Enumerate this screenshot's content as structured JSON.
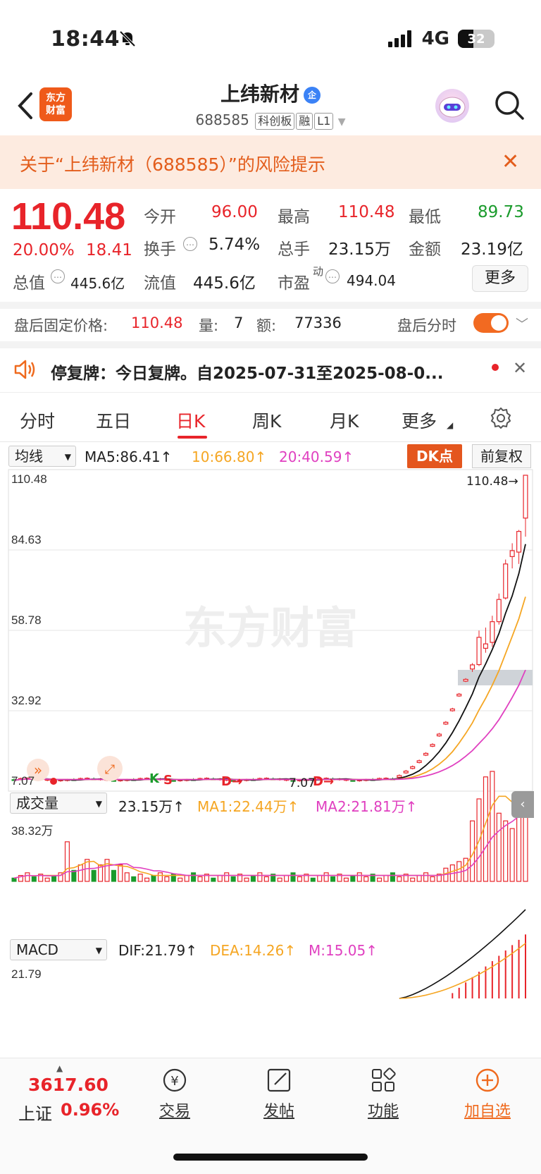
{
  "status": {
    "time": "18:44",
    "network": "4G",
    "battery": "32"
  },
  "header": {
    "logo": "东方财富",
    "title": "上纬新材",
    "title_badge": "企",
    "code": "688585",
    "tags": [
      "科创板",
      "融",
      "L1"
    ]
  },
  "risk_banner": {
    "text": "关于“上纬新材（688585）”的风险提示"
  },
  "quote": {
    "price": "110.48",
    "change_pct": "20.00%",
    "change": "18.41",
    "open_label": "今开",
    "open": "96.00",
    "high_label": "最高",
    "high": "110.48",
    "low_label": "最低",
    "low": "89.73",
    "turnover_label": "换手",
    "turnover": "5.74%",
    "volume_label": "总手",
    "volume": "23.15万",
    "amount_label": "金额",
    "amount": "23.19亿",
    "mktcap_label": "总值",
    "mktcap": "445.6亿",
    "float_label": "流值",
    "float": "445.6亿",
    "pe_label": "市盈",
    "pe_sup": "动",
    "pe": "494.04",
    "more": "更多"
  },
  "after_hours": {
    "label": "盘后固定价格:",
    "price": "110.48",
    "vol_label": "量:",
    "vol": "7",
    "amt_label": "额:",
    "amt": "77336",
    "timeshare": "盘后分时"
  },
  "notice": {
    "text": "停复牌：今日复牌。自2025-07-31至2025-08-0..."
  },
  "tabs": [
    "分时",
    "五日",
    "日K",
    "周K",
    "月K",
    "更多"
  ],
  "kline": {
    "indicator": "均线",
    "ma5": "MA5:86.41↑",
    "ma10": "10:66.80↑",
    "ma20": "20:40.59↑",
    "dk": "DK点",
    "adjust": "前复权",
    "y_labels": [
      "110.48",
      "84.63",
      "58.78",
      "32.92",
      "7.07"
    ],
    "last_label": "110.48→",
    "low_label": "7.07",
    "markers": [
      "K",
      "S",
      "D→",
      "D→"
    ],
    "watermark": "东方财富"
  },
  "volume": {
    "indicator": "成交量",
    "vol": "23.15万↑",
    "ma1": "MA1:22.44万↑",
    "ma2": "MA2:21.81万↑",
    "max_label": "38.32万"
  },
  "macd": {
    "indicator": "MACD",
    "dif": "DIF:21.79↑",
    "dea": "DEA:14.26↑",
    "m": "M:15.05↑",
    "max_label": "21.79"
  },
  "chart_data": {
    "type": "candlestick",
    "title": "",
    "ylim": [
      7.07,
      110.48
    ],
    "last_candles": [
      {
        "open": 45.0,
        "high": 47.0,
        "low": 44.0,
        "close": 46.4
      },
      {
        "open": 46.5,
        "high": 58.0,
        "low": 46.0,
        "close": 55.7
      },
      {
        "open": 52.0,
        "high": 59.0,
        "low": 50.5,
        "close": 53.5
      },
      {
        "open": 54.0,
        "high": 63.0,
        "low": 52.5,
        "close": 61.0
      },
      {
        "open": 61.0,
        "high": 70.5,
        "low": 60.0,
        "close": 68.5
      },
      {
        "open": 69.0,
        "high": 82.0,
        "low": 68.5,
        "close": 80.5
      },
      {
        "open": 83.0,
        "high": 87.5,
        "low": 79.0,
        "close": 85.0
      },
      {
        "open": 84.5,
        "high": 92.0,
        "low": 80.5,
        "close": 91.5
      },
      {
        "open": 96.0,
        "high": 110.48,
        "low": 89.73,
        "close": 110.48
      }
    ]
  },
  "index": {
    "value": "3617.60",
    "name": "上证",
    "pct": "0.96%"
  },
  "bottom_nav": [
    "交易",
    "发帖",
    "功能",
    "加自选"
  ],
  "colors": {
    "up": "#e8242a",
    "down": "#1a9b2c",
    "ma5": "#111111",
    "ma10": "#f5a623",
    "ma20": "#e040c0",
    "accent": "#ef6a1e"
  }
}
